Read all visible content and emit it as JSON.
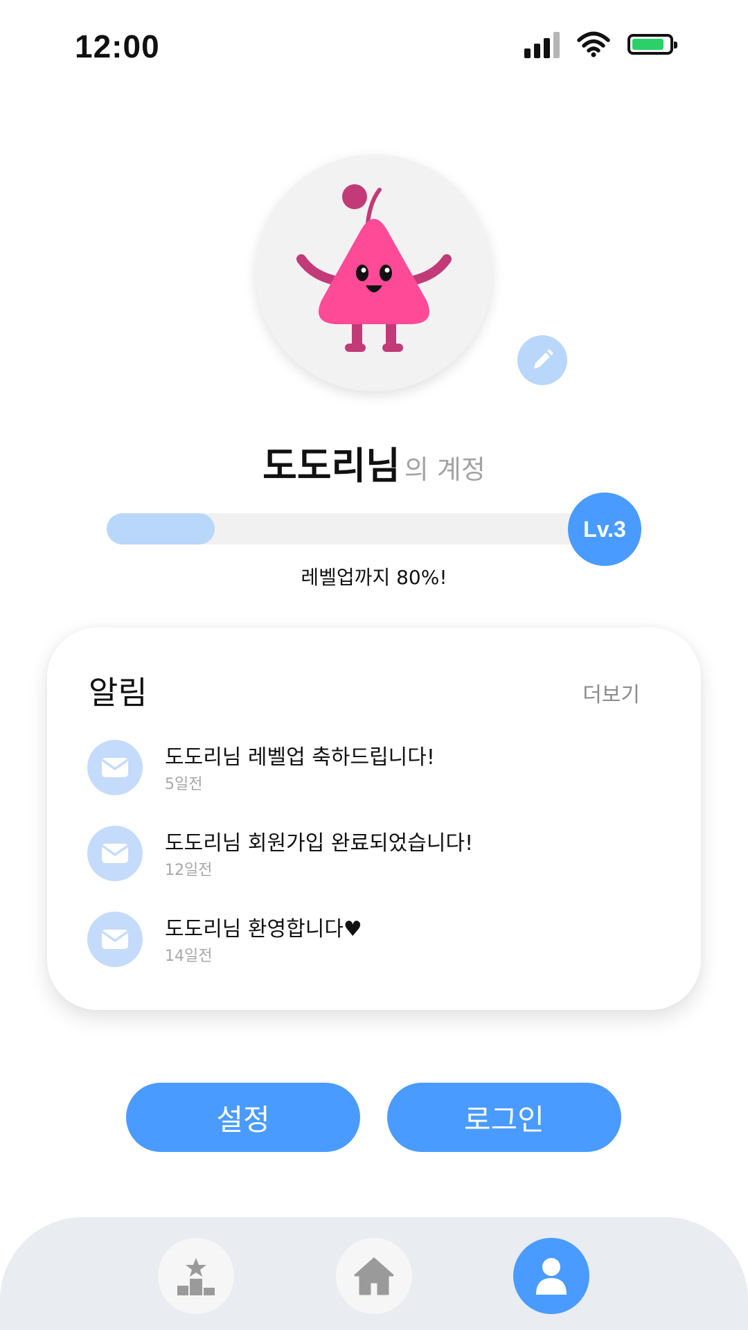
{
  "status_bar": {
    "time": "12:00",
    "battery_color": "#2bd168"
  },
  "profile": {
    "name": "도도리님",
    "suffix": "의 계정",
    "avatar_icon": "pink-pear-character",
    "edit_icon": "pencil-icon"
  },
  "level": {
    "badge": "Lv.3",
    "progress_text": "레벨업까지 80%!",
    "fill_fraction": 0.22
  },
  "notifications": {
    "title": "알림",
    "more": "더보기",
    "items": [
      {
        "text": "도도리님 레벨업 축하드립니다!",
        "time": "5일전"
      },
      {
        "text": "도도리님 회원가입 완료되었습니다!",
        "time": "12일전"
      },
      {
        "text": "도도리님 환영합니다♥",
        "time": "14일전"
      }
    ]
  },
  "buttons": {
    "settings": "설정",
    "login": "로그인"
  },
  "bottom_nav": {
    "items": [
      "ranking-icon",
      "home-icon",
      "profile-icon"
    ],
    "active": "profile-icon"
  },
  "colors": {
    "accent": "#4a9bff",
    "accent_light": "#b9d6fb",
    "character": "#ff4a98"
  }
}
